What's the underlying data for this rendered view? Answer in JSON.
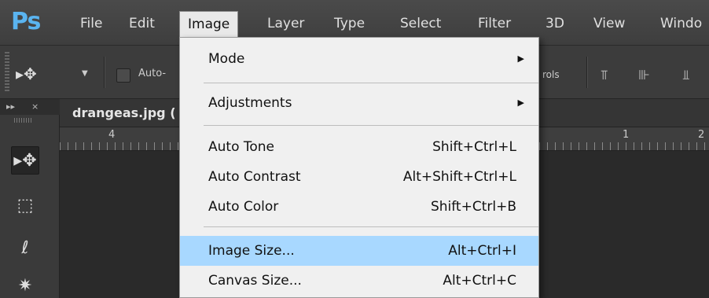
{
  "app": {
    "logo": "Ps"
  },
  "menubar": {
    "items": [
      "File",
      "Edit",
      "Image",
      "Layer",
      "Type",
      "Select",
      "Filter",
      "3D",
      "View",
      "Windo"
    ],
    "active": "Image"
  },
  "options_bar": {
    "auto_label": "Auto-",
    "controls_label": "rols"
  },
  "tool_panel": {
    "collapse_glyph": "▸▸",
    "close_glyph": "×"
  },
  "document": {
    "tab_label": "drangeas.jpg (",
    "ruler_numbers": [
      "4",
      "1",
      "2"
    ]
  },
  "image_menu": {
    "items": [
      {
        "label": "Mode",
        "shortcut": "",
        "submenu": true
      },
      {
        "label": "Adjustments",
        "shortcut": "",
        "submenu": true
      },
      {
        "label": "Auto Tone",
        "shortcut": "Shift+Ctrl+L",
        "submenu": false
      },
      {
        "label": "Auto Contrast",
        "shortcut": "Alt+Shift+Ctrl+L",
        "submenu": false
      },
      {
        "label": "Auto Color",
        "shortcut": "Shift+Ctrl+B",
        "submenu": false
      },
      {
        "label": "Image Size...",
        "shortcut": "Alt+Ctrl+I",
        "submenu": false,
        "highlighted": true
      },
      {
        "label": "Canvas Size...",
        "shortcut": "Alt+Ctrl+C",
        "submenu": false
      }
    ]
  },
  "colors": {
    "menubar": "#444444",
    "menu_bg": "#f0f0f0",
    "highlight": "#a8d8ff",
    "ps_blue": "#5ab4f0"
  }
}
